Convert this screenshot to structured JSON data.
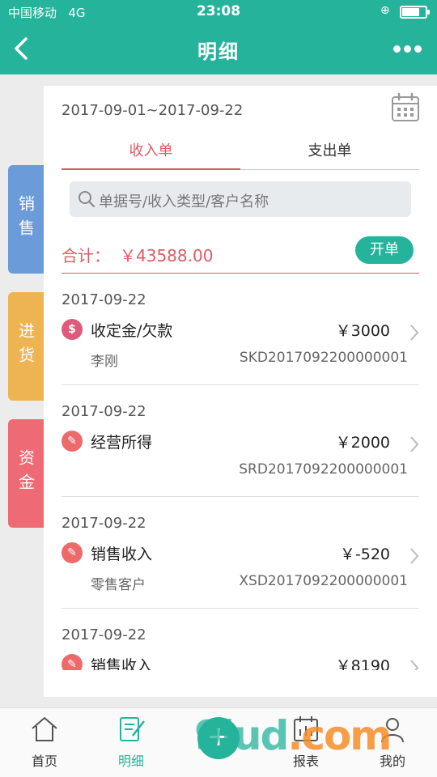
{
  "status_bar": {
    "carrier": "中国移动",
    "network": "4G",
    "time": "23:08",
    "battery_level": 0.75
  },
  "header": {
    "title": "明细"
  },
  "side_tabs": [
    "销售",
    "进货",
    "资金"
  ],
  "filter": {
    "date_range": "2017-09-01~2017-09-22"
  },
  "tabs": [
    {
      "label": "收入单",
      "active": true
    },
    {
      "label": "支出单",
      "active": false
    }
  ],
  "search": {
    "placeholder": "单据号/收入类型/客户名称"
  },
  "summary": {
    "label": "合计：",
    "total": "￥43588.00",
    "open_button": "开单"
  },
  "records": [
    {
      "date": "2017-09-22",
      "type": "收定金/欠款",
      "amount": "￥3000",
      "customer": "李刚",
      "doc_no": "SKD2017092200000001",
      "icon": "dollar-icon",
      "icon_color": "#e05a7a"
    },
    {
      "date": "2017-09-22",
      "type": "经营所得",
      "amount": "￥2000",
      "customer": "",
      "doc_no": "SRD2017092200000001",
      "icon": "note-icon",
      "icon_color": "#ee6a6a"
    },
    {
      "date": "2017-09-22",
      "type": "销售收入",
      "amount": "￥-520",
      "customer": "零售客户",
      "doc_no": "XSD2017092200000001",
      "icon": "note-icon",
      "icon_color": "#ee6a6a"
    },
    {
      "date": "2017-09-22",
      "type": "销售收入",
      "amount": "￥8190",
      "customer": "",
      "doc_no": "",
      "icon": "note-icon",
      "icon_color": "#ee6a6a"
    }
  ],
  "bottom_nav": [
    {
      "label": "首页",
      "icon": "home-icon",
      "active": false
    },
    {
      "label": "明细",
      "icon": "edit-icon",
      "active": true
    },
    {
      "label": "",
      "icon": "plus-icon",
      "active": false
    },
    {
      "label": "报表",
      "icon": "report-icon",
      "active": false
    },
    {
      "label": "我的",
      "icon": "user-icon",
      "active": false
    }
  ],
  "watermark": {
    "brand": "9lud",
    "suffix": ".com"
  },
  "colors": {
    "primary": "#26b39b",
    "accent": "#e05a64",
    "sales": "#6b9bd8",
    "purchase": "#efb452",
    "fund": "#ee6a74"
  }
}
